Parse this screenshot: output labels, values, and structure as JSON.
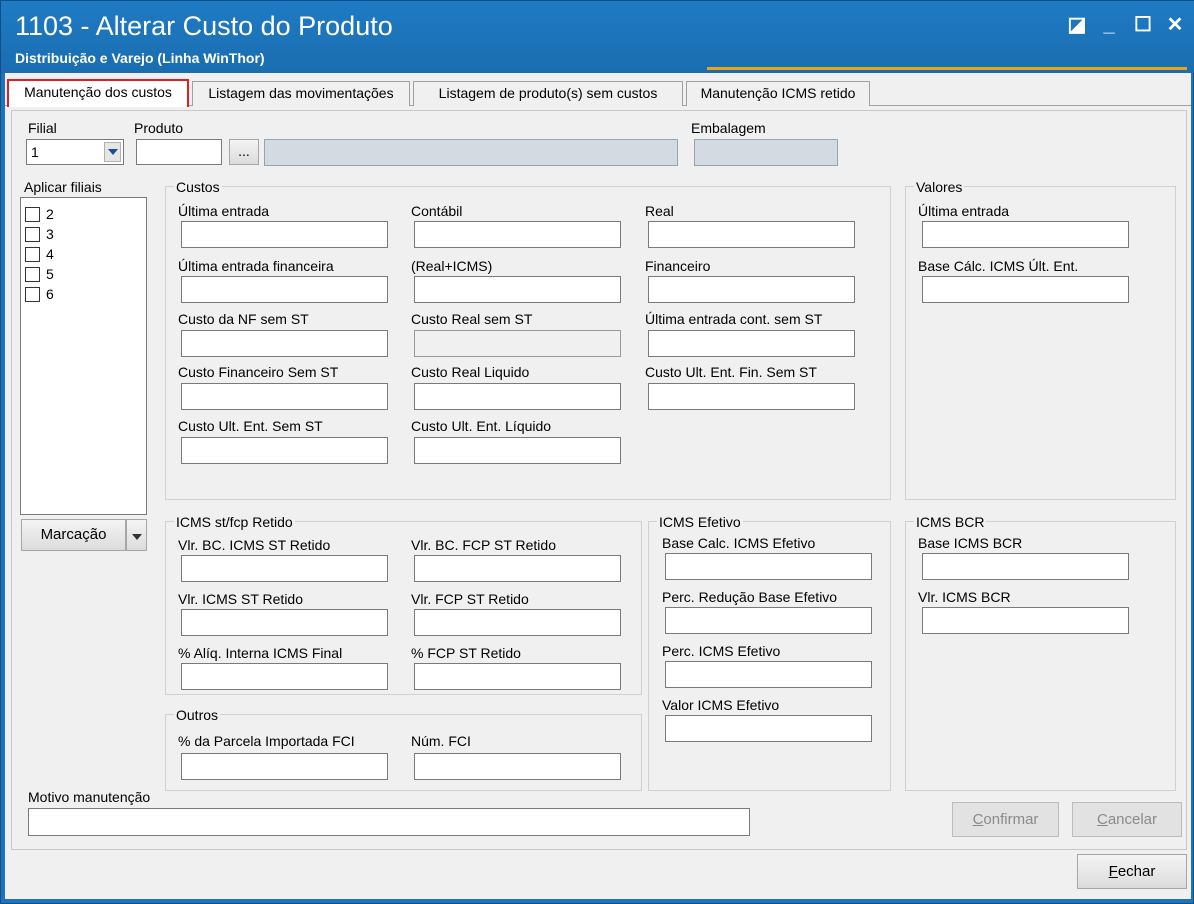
{
  "window": {
    "title": "1103 - Alterar Custo do Produto",
    "subtitle": "Distribuição e Varejo (Linha WinThor)",
    "controls": {
      "restore": "◪",
      "minimize": "_",
      "maximize": "☐",
      "close": "✕"
    }
  },
  "tabs": [
    {
      "label": "Manutenção dos custos",
      "active": true
    },
    {
      "label": "Listagem das movimentações"
    },
    {
      "label": "Listagem de produto(s)  sem custos"
    },
    {
      "label": "Manutenção ICMS retido"
    }
  ],
  "header": {
    "filial_label": "Filial",
    "filial_value": "1",
    "produto_label": "Produto",
    "produto_button": "...",
    "embalagem_label": "Embalagem"
  },
  "aplicar": {
    "label": "Aplicar filiais",
    "items": [
      "2",
      "3",
      "4",
      "5",
      "6"
    ],
    "marcacao_label": "Marcação"
  },
  "custos": {
    "title": "Custos",
    "col1": [
      "Última entrada",
      "Última entrada financeira",
      "Custo da NF sem ST",
      "Custo Financeiro Sem ST",
      "Custo Ult. Ent. Sem ST"
    ],
    "col2": [
      "Contábil",
      "(Real+ICMS)",
      "Custo Real sem ST",
      "Custo Real Liquido",
      "Custo Ult. Ent. Líquido"
    ],
    "col3": [
      "Real",
      "Financeiro",
      "Última entrada cont. sem ST",
      "Custo Ult. Ent. Fin. Sem ST"
    ]
  },
  "valores": {
    "title": "Valores",
    "fields": [
      "Última entrada",
      "Base Cálc. ICMS Últ. Ent."
    ]
  },
  "icms_st": {
    "title": "ICMS st/fcp Retido",
    "col1": [
      "Vlr. BC. ICMS ST Retido",
      "Vlr. ICMS ST Retido",
      "% Alíq. Interna ICMS Final"
    ],
    "col2": [
      "Vlr. BC. FCP ST Retido",
      "Vlr. FCP ST Retido",
      "% FCP ST Retido"
    ]
  },
  "icms_efetivo": {
    "title": "ICMS Efetivo",
    "fields": [
      "Base Calc. ICMS Efetivo",
      "Perc. Redução Base Efetivo",
      "Perc. ICMS Efetivo",
      "Valor ICMS Efetivo"
    ]
  },
  "icms_bcr": {
    "title": "ICMS BCR",
    "fields": [
      "Base ICMS BCR",
      "Vlr. ICMS BCR"
    ]
  },
  "outros": {
    "title": "Outros",
    "fields": [
      "% da Parcela Importada FCI",
      "Núm. FCI"
    ]
  },
  "motivo": {
    "label": "Motivo manutenção"
  },
  "buttons": {
    "confirmar_first": "C",
    "confirmar_rest": "onfirmar",
    "cancelar_first": "C",
    "cancelar_rest": "ancelar",
    "fechar_first": "F",
    "fechar_rest": "echar"
  }
}
